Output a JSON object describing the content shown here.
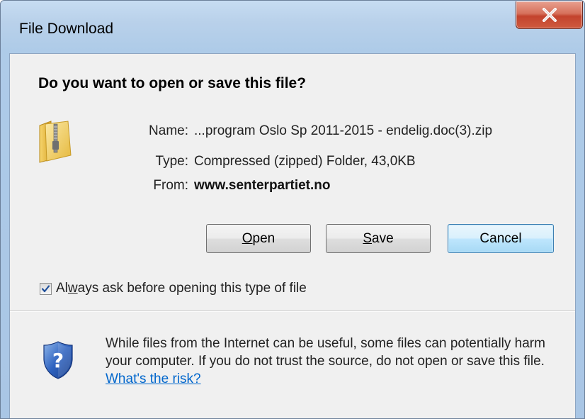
{
  "window": {
    "title": "File Download",
    "close_glyph": "x"
  },
  "dialog": {
    "question": "Do you want to open or save this file?",
    "file_icon": "zip-folder-icon",
    "fields": {
      "name_label": "Name:",
      "name_value": "...program Oslo Sp 2011-2015 - endelig.doc(3).zip",
      "type_label": "Type:",
      "type_value": "Compressed (zipped) Folder, 43,0KB",
      "from_label": "From:",
      "from_value": "www.senterpartiet.no"
    },
    "buttons": {
      "open_mnemonic": "O",
      "open_rest": "pen",
      "save_mnemonic": "S",
      "save_rest": "ave",
      "cancel": "Cancel"
    },
    "checkbox": {
      "checked": true,
      "label_before": "Al",
      "label_mnemonic": "w",
      "label_after": "ays ask before opening this type of file"
    }
  },
  "warning": {
    "icon": "shield-question-icon",
    "text": "While files from the Internet can be useful, some files can potentially harm your computer. If you do not trust the source, do not open or save this file.",
    "link": "What's the risk?"
  },
  "colors": {
    "link": "#0066cc",
    "close_button": "#c3432d",
    "default_button_border": "#3c7fb1",
    "titlebar": "#b9d1ea"
  }
}
